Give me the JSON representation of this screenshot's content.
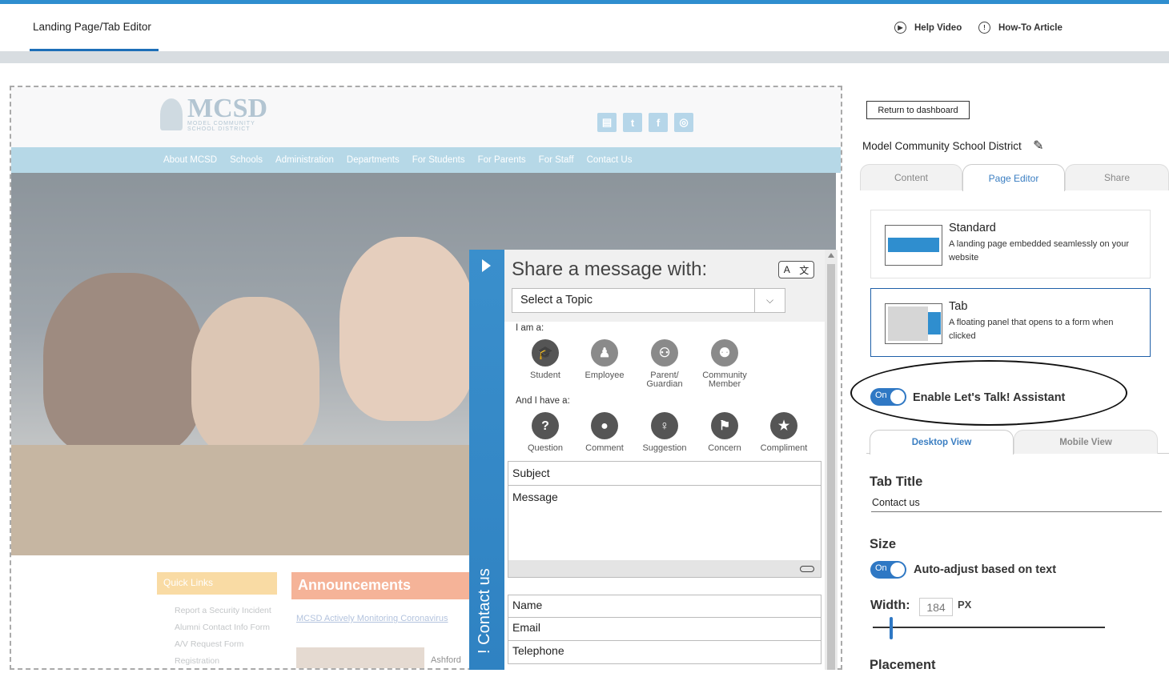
{
  "header": {
    "tab": "Landing Page/Tab Editor",
    "help_video": "Help Video",
    "how_to": "How-To Article"
  },
  "site": {
    "logo_big": "MCSD",
    "logo_small": "MODEL COMMUNITY SCHOOL DISTRICT",
    "nav": [
      "About MCSD",
      "Schools",
      "Administration",
      "Departments",
      "For Students",
      "For Parents",
      "For Staff",
      "Contact Us"
    ],
    "quick_links_title": "Quick Links",
    "quick_links": [
      "Report a Security Incident",
      "Alumni Contact Info Form",
      "A/V Request Form",
      "Registration"
    ],
    "announcements_title": "Announcements",
    "announcement_link": "MCSD Actively Monitoring Coronavirus",
    "announcement_school": "Ashford"
  },
  "widget": {
    "tab_label": "Contact us",
    "tab_prefix": "!",
    "title": "Share a message with:",
    "topic_placeholder": "Select a Topic",
    "i_am": "I am a:",
    "roles": [
      {
        "label": "Student",
        "icon": "graduation-cap-icon"
      },
      {
        "label": "Employee",
        "icon": "employee-icon"
      },
      {
        "label": "Parent/ Guardian",
        "icon": "parent-guardian-icon"
      },
      {
        "label": "Community Member",
        "icon": "community-icon"
      }
    ],
    "i_have": "And I have a:",
    "types": [
      {
        "label": "Question",
        "icon": "question-icon"
      },
      {
        "label": "Comment",
        "icon": "comment-icon"
      },
      {
        "label": "Suggestion",
        "icon": "lightbulb-icon"
      },
      {
        "label": "Concern",
        "icon": "flag-icon"
      },
      {
        "label": "Compliment",
        "icon": "star-icon"
      }
    ],
    "subject": "Subject",
    "message": "Message",
    "name": "Name",
    "email": "Email",
    "telephone": "Telephone"
  },
  "panel": {
    "return_button": "Return to dashboard",
    "org_name": "Model Community School District",
    "tabs": [
      "Content",
      "Page Editor",
      "Share"
    ],
    "active_tab": "Page Editor",
    "standard_title": "Standard",
    "standard_desc": "A landing page embedded seamlessly on your website",
    "tab_title": "Tab",
    "tab_desc": "A floating panel that opens to a form when clicked",
    "assistant_toggle": "On",
    "assistant_label": "Enable Let's Talk! Assistant",
    "view_tabs": [
      "Desktop View",
      "Mobile View"
    ],
    "tab_title_heading": "Tab Title",
    "tab_title_value": "Contact us",
    "size_heading": "Size",
    "auto_toggle": "On",
    "auto_label": "Auto-adjust based on text",
    "width_label": "Width:",
    "width_value": "184",
    "width_unit": "PX",
    "placement_heading": "Placement"
  },
  "colors": {
    "accent": "#2f8ecf",
    "toggle": "#2f78c4",
    "widget_strip": "#3a8fcc"
  }
}
